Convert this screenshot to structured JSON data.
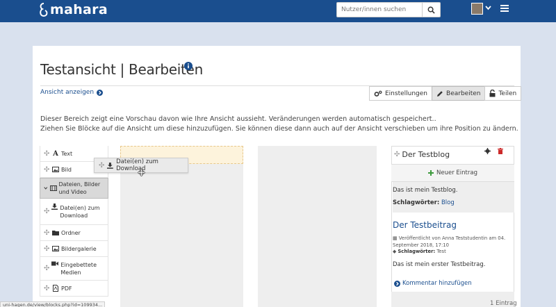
{
  "header": {
    "logo_text": "mahara",
    "search_placeholder": "Nutzer/innen suchen"
  },
  "page": {
    "title": "Testansicht | Bearbeiten",
    "view_link": "Ansicht anzeigen",
    "description_line1": "Dieser Bereich zeigt eine Vorschau davon wie Ihre Ansicht aussieht. Veränderungen werden automatisch gespeichert..",
    "description_line2": "Ziehen Sie Blöcke auf die Ansicht um diese hinzuzufügen. Sie können diese dann auch auf der Ansicht verschieben um ihre Position zu ändern."
  },
  "toolbar": {
    "settings_label": "Einstellungen",
    "edit_label": "Bearbeiten",
    "share_label": "Teilen"
  },
  "palette": {
    "items": [
      {
        "label": "Text"
      },
      {
        "label": "Bild"
      },
      {
        "label": "Dateien, Bilder und Video"
      },
      {
        "label": "Datei(en) zum Download"
      },
      {
        "label": "Ordner"
      },
      {
        "label": "Bildergalerie"
      },
      {
        "label": "Eingebettete Medien"
      },
      {
        "label": "PDF"
      }
    ]
  },
  "drag": {
    "label": "Datei(en) zum Download"
  },
  "blog": {
    "title": "Der Testblog",
    "new_entry": "Neuer Eintrag",
    "description": "Das ist mein Testblog.",
    "tags_label": "Schlagwörter:",
    "tags_value": "Blog",
    "post_title": "Der Testbeitrag",
    "post_meta": "Veröffentlicht von Anna Teststudentin am 04. September 2018, 17:10",
    "post_tags_label": "Schlagwörter:",
    "post_tags_value": "Test",
    "post_body": "Das ist mein erster Testbeitrag.",
    "comment_link": "Kommentar hinzufügen",
    "entry_count": "1 Eintrag"
  },
  "statusbar": {
    "url": "uni-hagen.de/view/blocks.php?id=109934..."
  },
  "colors": {
    "brand": "#1a4e8e",
    "add_green": "#3c9a3c",
    "delete_red": "#cc2a2a"
  }
}
